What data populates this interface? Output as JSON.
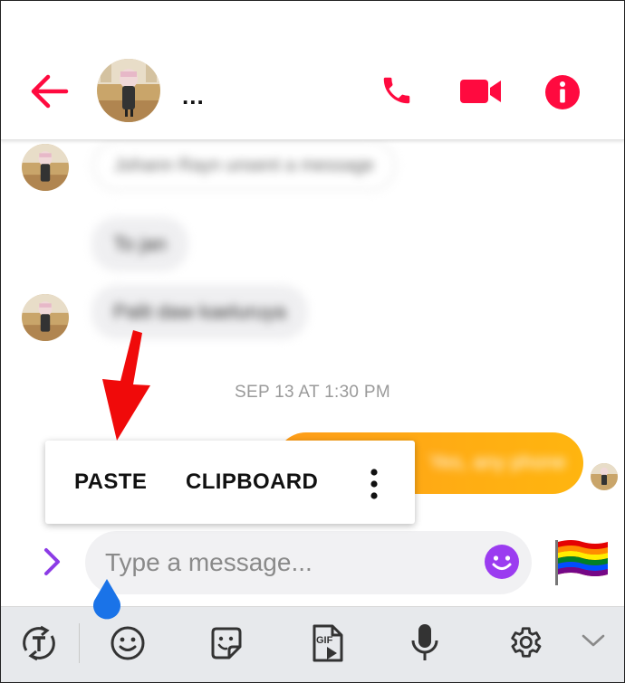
{
  "header": {
    "contact_name": "...",
    "back_icon": "arrow-left-icon",
    "call_icon": "phone-icon",
    "video_icon": "video-camera-icon",
    "info_icon": "info-icon",
    "accent_color": "#ff0a3f"
  },
  "chat": {
    "system_message": "Johann Rayn unsent a message",
    "incoming_messages": [
      "To jan",
      "Palit daw kaeluruya"
    ],
    "timestamp": "SEP 13 AT 1:30 PM",
    "outgoing_message": "Yes, any phone",
    "outgoing_color": "#ffa81a"
  },
  "context_menu": {
    "paste_label": "PASTE",
    "clipboard_label": "CLIPBOARD",
    "more_icon": "more-vertical-icon"
  },
  "composer": {
    "placeholder": "Type a message...",
    "expand_icon": "chevron-right-icon",
    "emoji_icon": "emoji-icon",
    "flag_emoji": "🏳️‍🌈"
  },
  "keyboard_toolbar": {
    "icons": [
      "text-translate-icon",
      "emoji-icon",
      "sticker-icon",
      "gif-icon",
      "microphone-icon",
      "settings-icon",
      "chevron-down-icon"
    ],
    "gif_label": "GIF"
  }
}
